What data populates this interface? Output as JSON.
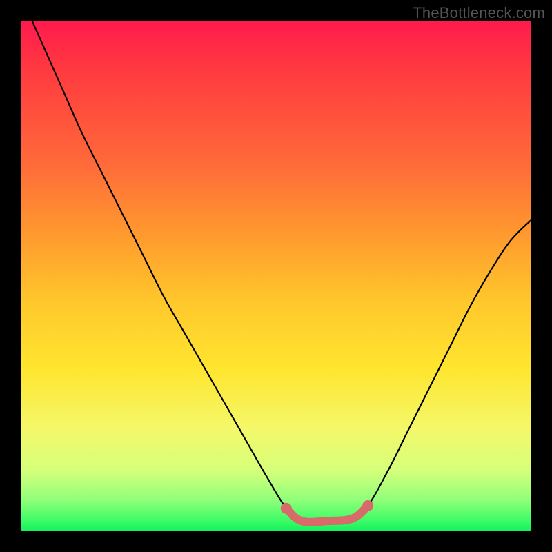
{
  "watermark": "TheBottleneck.com",
  "chart_data": {
    "type": "line",
    "title": "",
    "xlabel": "",
    "ylabel": "",
    "xlim": [
      0,
      1
    ],
    "ylim": [
      0,
      1
    ],
    "series": [
      {
        "name": "bottleneck-curve",
        "x": [
          0.0,
          0.04,
          0.08,
          0.12,
          0.16,
          0.2,
          0.24,
          0.28,
          0.32,
          0.36,
          0.4,
          0.44,
          0.48,
          0.52,
          0.55,
          0.6,
          0.65,
          0.68,
          0.72,
          0.76,
          0.8,
          0.84,
          0.88,
          0.92,
          0.96,
          1.0
        ],
        "y": [
          1.05,
          0.96,
          0.87,
          0.78,
          0.7,
          0.62,
          0.54,
          0.46,
          0.39,
          0.32,
          0.25,
          0.18,
          0.11,
          0.045,
          0.02,
          0.02,
          0.025,
          0.05,
          0.12,
          0.2,
          0.28,
          0.36,
          0.44,
          0.51,
          0.57,
          0.61
        ]
      },
      {
        "name": "flat-bottom-highlight",
        "x": [
          0.52,
          0.55,
          0.6,
          0.65,
          0.68
        ],
        "y": [
          0.045,
          0.02,
          0.02,
          0.025,
          0.05
        ]
      }
    ],
    "colors": {
      "curve": "#000000",
      "highlight": "#d96a6a",
      "gradient_top": "#ff1a4d",
      "gradient_bottom": "#13f05c"
    }
  }
}
